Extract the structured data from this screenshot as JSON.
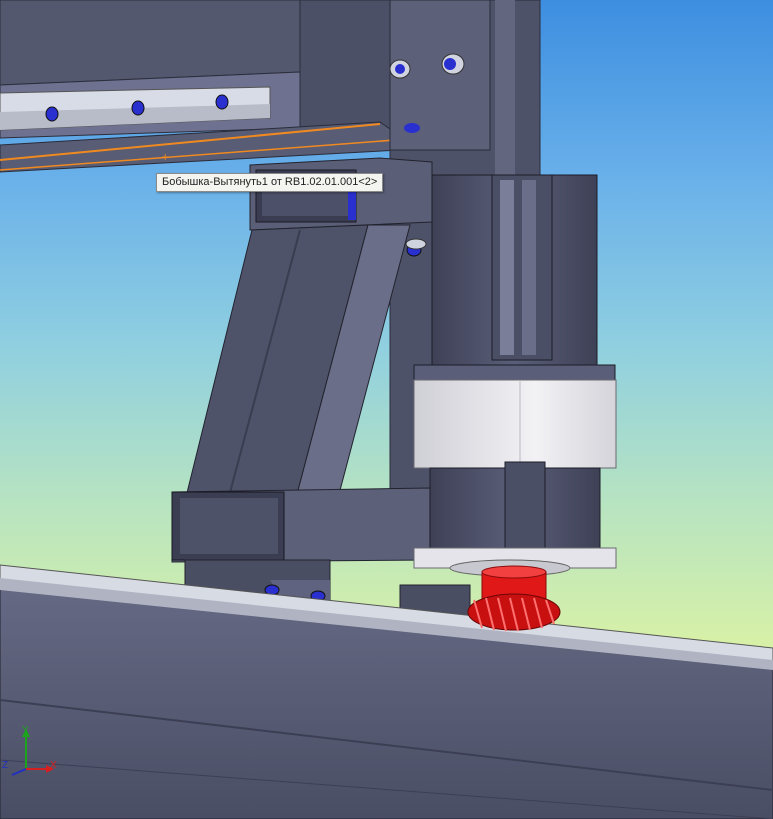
{
  "viewport": {
    "tooltip_text": "Бобышка-Вытянуть1 от RB1.02.01.001<2>"
  },
  "triad": {
    "x_label": "X",
    "y_label": "Y",
    "z_label": "Z"
  },
  "colors": {
    "steel": "#5b6078",
    "steel_dark": "#3a3d52",
    "steel_light": "#8a8ea8",
    "gear_red": "#e01818",
    "motor_white": "#e8e8ec",
    "bolt_blue": "#2a2fd0",
    "highlight_orange": "#f08a20"
  }
}
